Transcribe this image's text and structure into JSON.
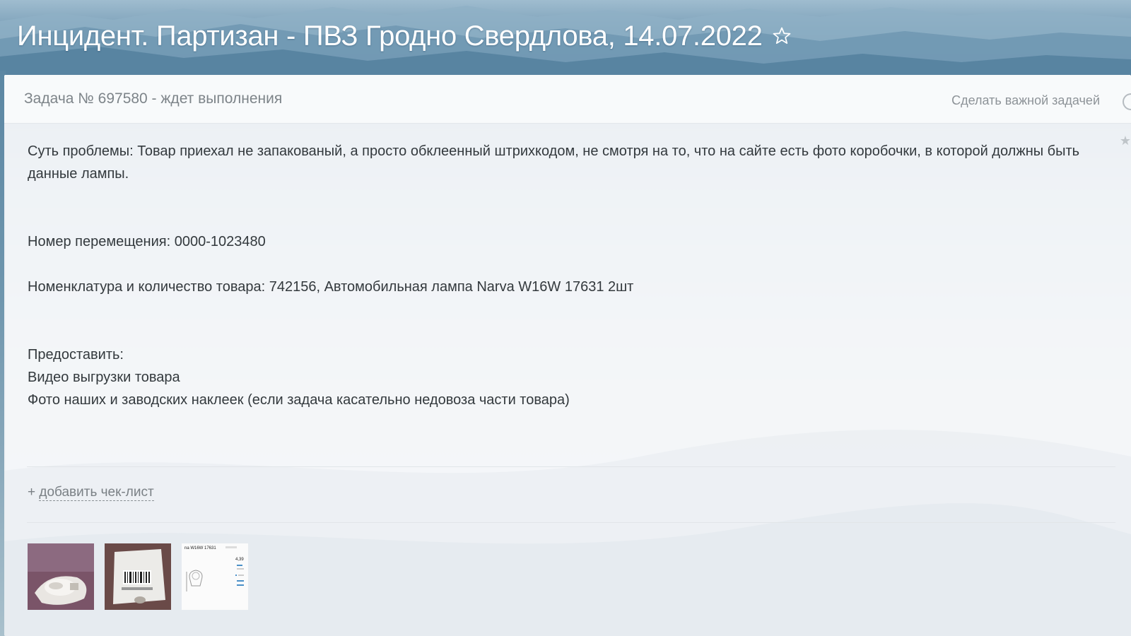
{
  "header": {
    "title": "Инцидент. Партизан - ПВЗ Гродно Свердлова, 14.07.2022",
    "favorite_icon": "star-outline-icon"
  },
  "task": {
    "number_status": "Задача № 697580 - ждет выполнения",
    "make_important": "Сделать важной задачей"
  },
  "description": {
    "problem": "Суть проблемы: Товар приехал не запакованый, а просто обклеенный штрихкодом, не смотря на то, что на сайте есть фото коробочки, в которой должны быть данные лампы.",
    "transfer_number": "Номер перемещения: 0000-1023480",
    "nomenclature": "Номенклатура и количество товара:  742156, Автомобильная лампа Narva W16W 17631 2шт",
    "provide_heading": "Предоставить:",
    "provide_items": [
      "Видео выгрузки товара",
      "Фото наших и заводских наклеек (если задача касательно недовоза части товара)"
    ]
  },
  "checklist": {
    "plus": "+",
    "label": "добавить чек-лист"
  },
  "attachments": {
    "thumb3_caption": "na W16W 17631",
    "thumb3_price": "4,39"
  },
  "colors": {
    "header_sky": "#5d8aa8",
    "panel_bg": "#f6f8fa",
    "text_main": "#33393d",
    "text_muted": "#7d8489"
  }
}
